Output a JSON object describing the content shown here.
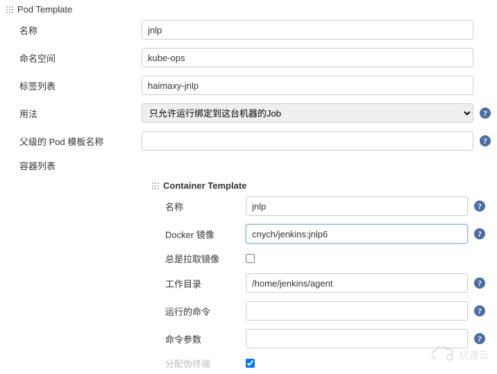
{
  "pod_template": {
    "title": "Pod Template",
    "fields": {
      "name": {
        "label": "名称",
        "value": "jnlp"
      },
      "namespace": {
        "label": "命名空间",
        "value": "kube-ops"
      },
      "labels": {
        "label": "标签列表",
        "value": "haimaxy-jnlp"
      },
      "usage": {
        "label": "用法",
        "selected": "只允许运行绑定到这台机器的Job"
      },
      "parent_template": {
        "label": "父级的 Pod 模板名称",
        "value": ""
      },
      "containers": {
        "label": "容器列表"
      }
    }
  },
  "container_template": {
    "title": "Container Template",
    "fields": {
      "name": {
        "label": "名称",
        "value": "jnlp"
      },
      "docker_image": {
        "label": "Docker 镜像",
        "value": "cnych/jenkins:jnlp6"
      },
      "always_pull": {
        "label": "总是拉取镜像",
        "checked": false
      },
      "working_dir": {
        "label": "工作目录",
        "value": "/home/jenkins/agent"
      },
      "command": {
        "label": "运行的命令",
        "value": ""
      },
      "args": {
        "label": "命令参数",
        "value": ""
      },
      "allocate_tty": {
        "label": "分配伪终端",
        "checked": true
      }
    }
  },
  "watermark": "亿速云"
}
